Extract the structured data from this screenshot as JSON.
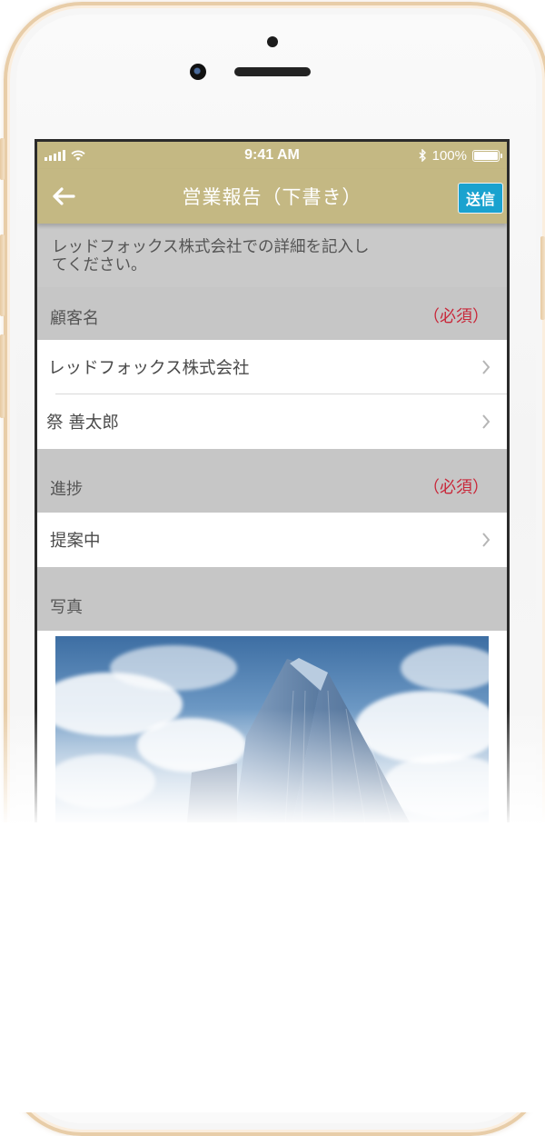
{
  "status_bar": {
    "time": "9:41 AM",
    "battery": "100%"
  },
  "nav": {
    "title": "営業報告（下書き）",
    "send_label": "送信"
  },
  "intro_text_line1": "レッドフォックス株式会社での詳細を記入し",
  "intro_text_line2": "てください。",
  "sections": {
    "customer": {
      "label": "顧客名",
      "required": "（必須）",
      "company": "レッドフォックス株式会社",
      "person": "祭 善太郎"
    },
    "progress": {
      "label": "進捗",
      "required": "（必須）",
      "value": "提案中"
    },
    "photo": {
      "label": "写真"
    }
  },
  "colors": {
    "accent": "#c4b883",
    "send": "#1aa2cf",
    "required": "#c8283a"
  }
}
